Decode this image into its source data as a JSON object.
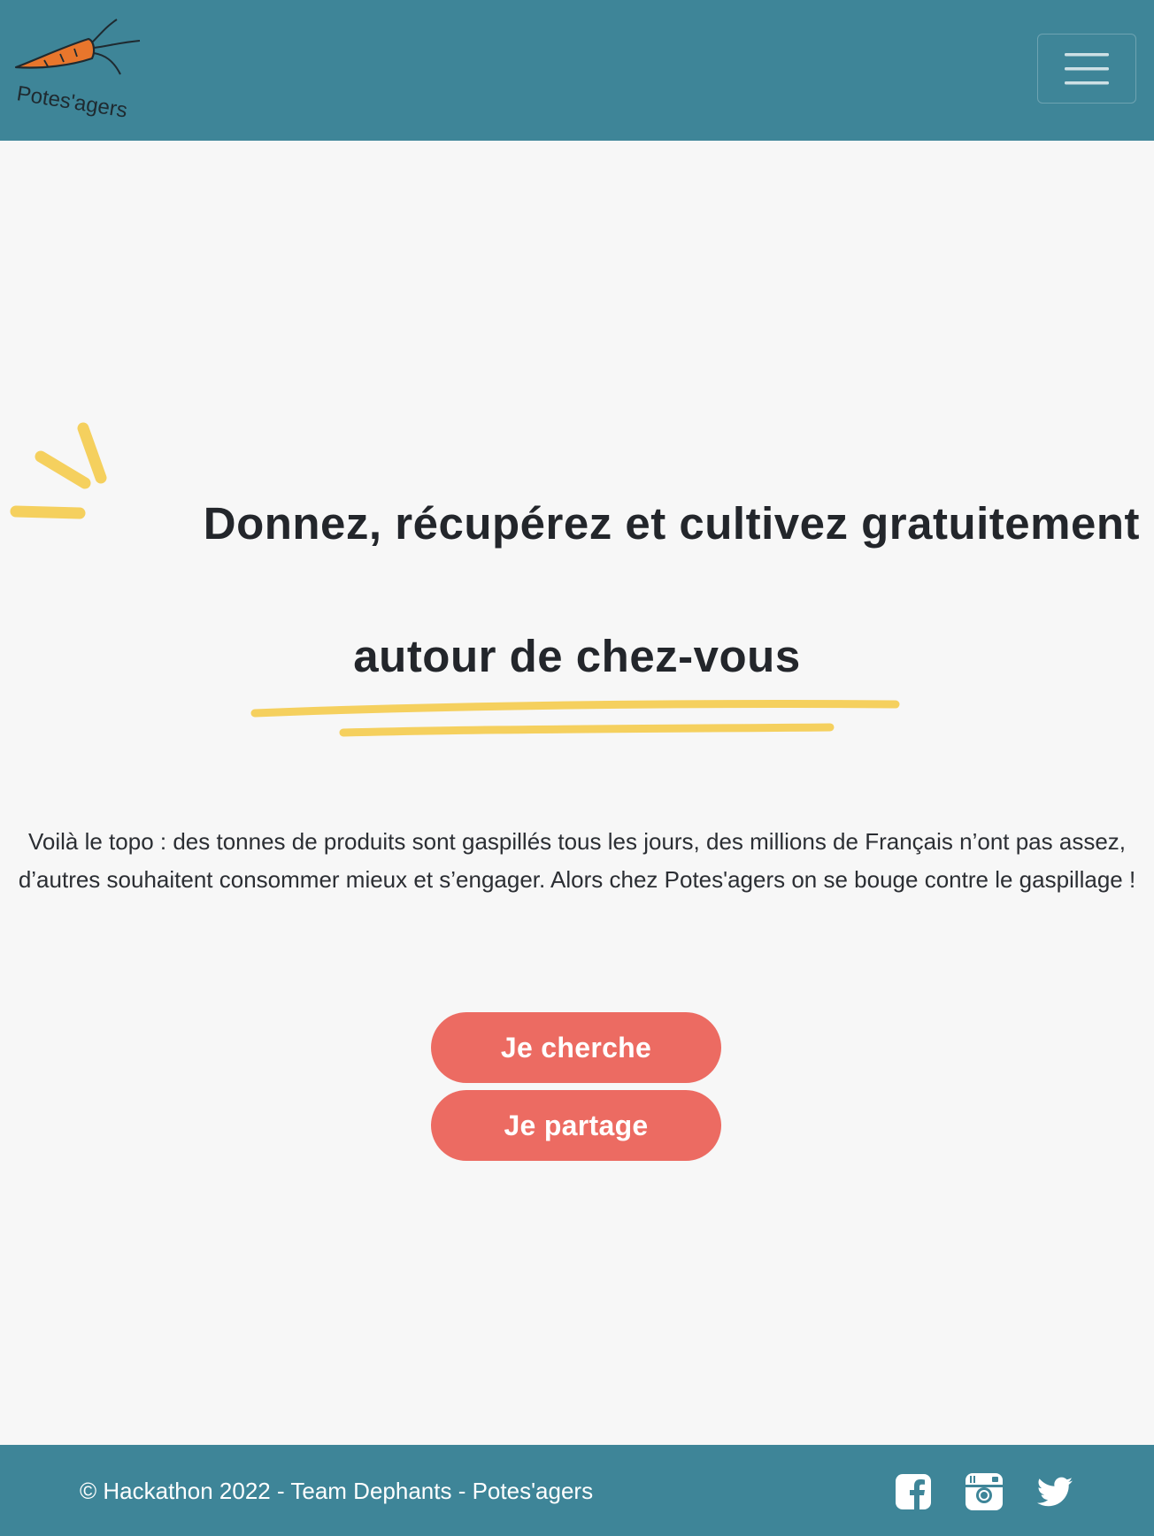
{
  "header": {
    "logo_text": "Potes'agers",
    "menu_icon": "hamburger-menu-icon"
  },
  "hero": {
    "headline_line1": "Donnez, récupérez et cultivez gratuitement",
    "headline_line2": "autour de chez-vous",
    "intro_line1": "Voilà le topo : des tonnes de produits sont gaspillés tous les jours, des millions de Français n’ont pas assez,",
    "intro_line2": "d’autres souhaitent consommer mieux et s’engager. Alors chez Potes'agers on se bouge contre le gaspillage !",
    "button_search": "Je cherche",
    "button_share": "Je partage"
  },
  "footer": {
    "copyright": "© Hackathon 2022 - Team Dephants - Potes'agers",
    "social_icons": [
      "facebook-icon",
      "instagram-icon",
      "twitter-icon"
    ]
  },
  "colors": {
    "header_bg": "#3e8598",
    "page_bg": "#f7f7f7",
    "accent_yellow": "#f5d05e",
    "button_red": "#ec6b62",
    "carrot_orange": "#e8762c",
    "text_dark": "#23262b"
  }
}
